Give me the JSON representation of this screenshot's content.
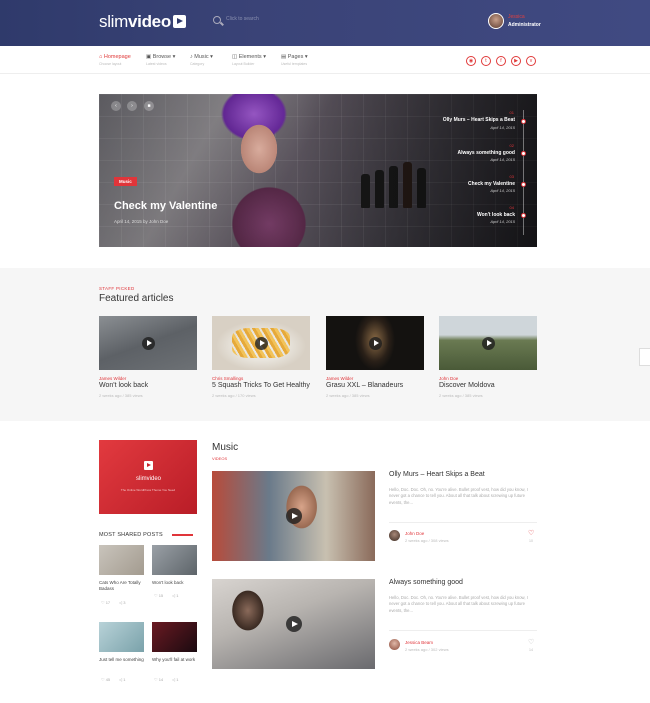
{
  "brand": {
    "logo_light": "slim",
    "logo_bold": "video"
  },
  "header": {
    "search_placeholder": "Click to search",
    "user_name": "Jessica",
    "user_role": "Administrator"
  },
  "nav": [
    {
      "label": "Homepage",
      "sub": "Choose layout"
    },
    {
      "label": "Browse",
      "sub": "Latest videos"
    },
    {
      "label": "Music",
      "sub": "Category"
    },
    {
      "label": "Elements",
      "sub": "Layout Builder"
    },
    {
      "label": "Pages",
      "sub": "Useful templates"
    }
  ],
  "social": [
    "rss-icon",
    "twitter-icon",
    "facebook-icon",
    "youtube-icon",
    "vimeo-icon"
  ],
  "hero": {
    "tag": "Music",
    "title": "Check my Valentine",
    "meta": "April 14, 2015 by John Doe",
    "playlist": [
      {
        "num": "01",
        "title": "Olly Murs – Heart Skips a Beat",
        "date": "April 14, 2015"
      },
      {
        "num": "02",
        "title": "Always something good",
        "date": "April 14, 2015"
      },
      {
        "num": "03",
        "title": "Check my Valentine",
        "date": "April 14, 2015"
      },
      {
        "num": "04",
        "title": "Won't look back",
        "date": "April 14, 2015"
      }
    ]
  },
  "featured": {
    "kicker": "STAFF PICKED",
    "title": "Featured articles",
    "cards": [
      {
        "author": "James Wilder",
        "title": "Won't look back",
        "meta": "2 weeks ago / 385 views"
      },
      {
        "author": "Chris Smallings",
        "title": "5 Squash Tricks To Get Healthy",
        "meta": "2 weeks ago / 170 views"
      },
      {
        "author": "James Wilder",
        "title": "Grasu XXL – Blanadeurs",
        "meta": "2 weeks ago / 385 views"
      },
      {
        "author": "John Doe",
        "title": "Discover Moldova",
        "meta": "2 weeks ago / 385 views"
      }
    ]
  },
  "promo": {
    "logo": "slimvideo",
    "sub": "The Online WordPress Theme You Need"
  },
  "most_shared": {
    "title": "MOST SHARED POSTS",
    "posts": [
      {
        "caption": "Cats Who Are Totally Badass",
        "views": "17",
        "shares": "3"
      },
      {
        "caption": "Won't look back",
        "views": "15",
        "shares": "1"
      },
      {
        "caption": "Just tell me something",
        "views": "45",
        "shares": "1"
      },
      {
        "caption": "Why you'll fail at work",
        "views": "14",
        "shares": "1"
      }
    ]
  },
  "music": {
    "title": "Music",
    "sub": "VIDEOS",
    "articles": [
      {
        "title": "Olly Murs – Heart Skips a Beat",
        "text": "Hello, Doc. Doc. Oh, no. You're alive. Bullet proof vest, how did you know, I never got a chance to tell you. About all that talk about screwing up future events, the...",
        "author": "John Doe",
        "meta": "2 weeks ago / 308 views",
        "likes": "10"
      },
      {
        "title": "Always something good",
        "text": "Hello, Doc. Doc. Oh, no. You're alive. Bullet proof vest, how did you know, I never got a chance to tell you. About all that talk about screwing up future events, the...",
        "author": "Jessica Beam",
        "meta": "2 weeks ago / 302 views",
        "likes": "14"
      }
    ]
  }
}
